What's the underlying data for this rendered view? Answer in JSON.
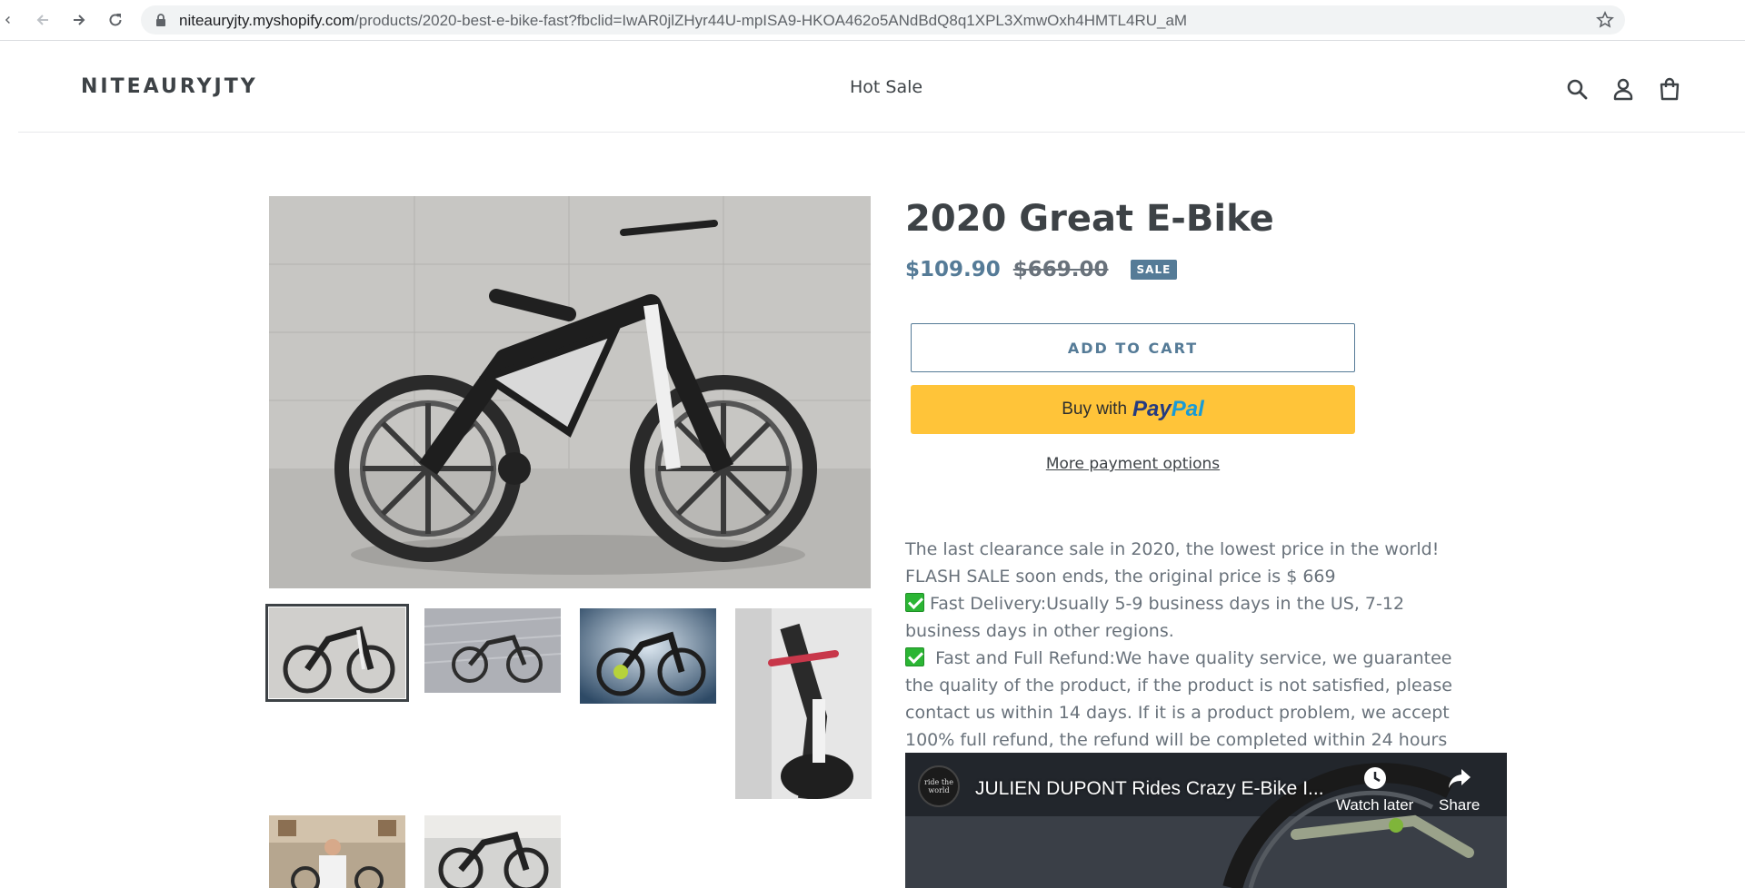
{
  "browser": {
    "url_host": "niteauryjty.myshopify.com",
    "url_path": "/products/2020-best-e-bike-fast?fbclid=IwAR0jlZHyr44U-mpISA9-HKOA462o5ANdBdQ8q1XPL3XmwOxh4HMTL4RU_aM",
    "icons": [
      "back-arrow-icon",
      "forward-arrow-icon",
      "reload-icon",
      "lock-icon",
      "bookmark-star-icon"
    ]
  },
  "header": {
    "logo": "NITEAURYJTY",
    "nav": [
      "Hot Sale"
    ],
    "icons": [
      "search-icon",
      "account-icon",
      "cart-icon"
    ]
  },
  "product": {
    "title": "2020 Great E-Bike",
    "price_sale": "$109.90",
    "price_regular": "$669.00",
    "badge": "SALE",
    "add_to_cart": "ADD TO CART",
    "paypal_prefix": "Buy with",
    "paypal_brand_a": "Pay",
    "paypal_brand_b": "Pal",
    "more_payment": "More payment options"
  },
  "gallery": {
    "thumbnail_count": 6,
    "active_thumbnail": 1
  },
  "description": {
    "lines": [
      "The last clearance sale in 2020, the lowest price in the world!",
      "FLASH SALE soon ends, the original price is $ 669",
      " Fast Delivery:Usually 5-9 business days in the US, 7-12",
      "business days in other regions.",
      "  Fast and Full Refund:We have quality service, we guarantee",
      "the quality of the product, if the product is not satisfied, please",
      "contact us within 14 days. If it is a product problem, we accept",
      "100% full refund, the refund will be completed within 24 hours"
    ]
  },
  "video": {
    "title": "JULIEN DUPONT Rides Crazy E-Bike I...",
    "channel_badge": "ride the world",
    "watch_later": "Watch later",
    "share": "Share"
  },
  "colors": {
    "accent": "#557b97",
    "text": "#3d4246",
    "muted": "#69727b",
    "paypal_yellow": "#ffc439",
    "check_green": "#2bb534"
  }
}
